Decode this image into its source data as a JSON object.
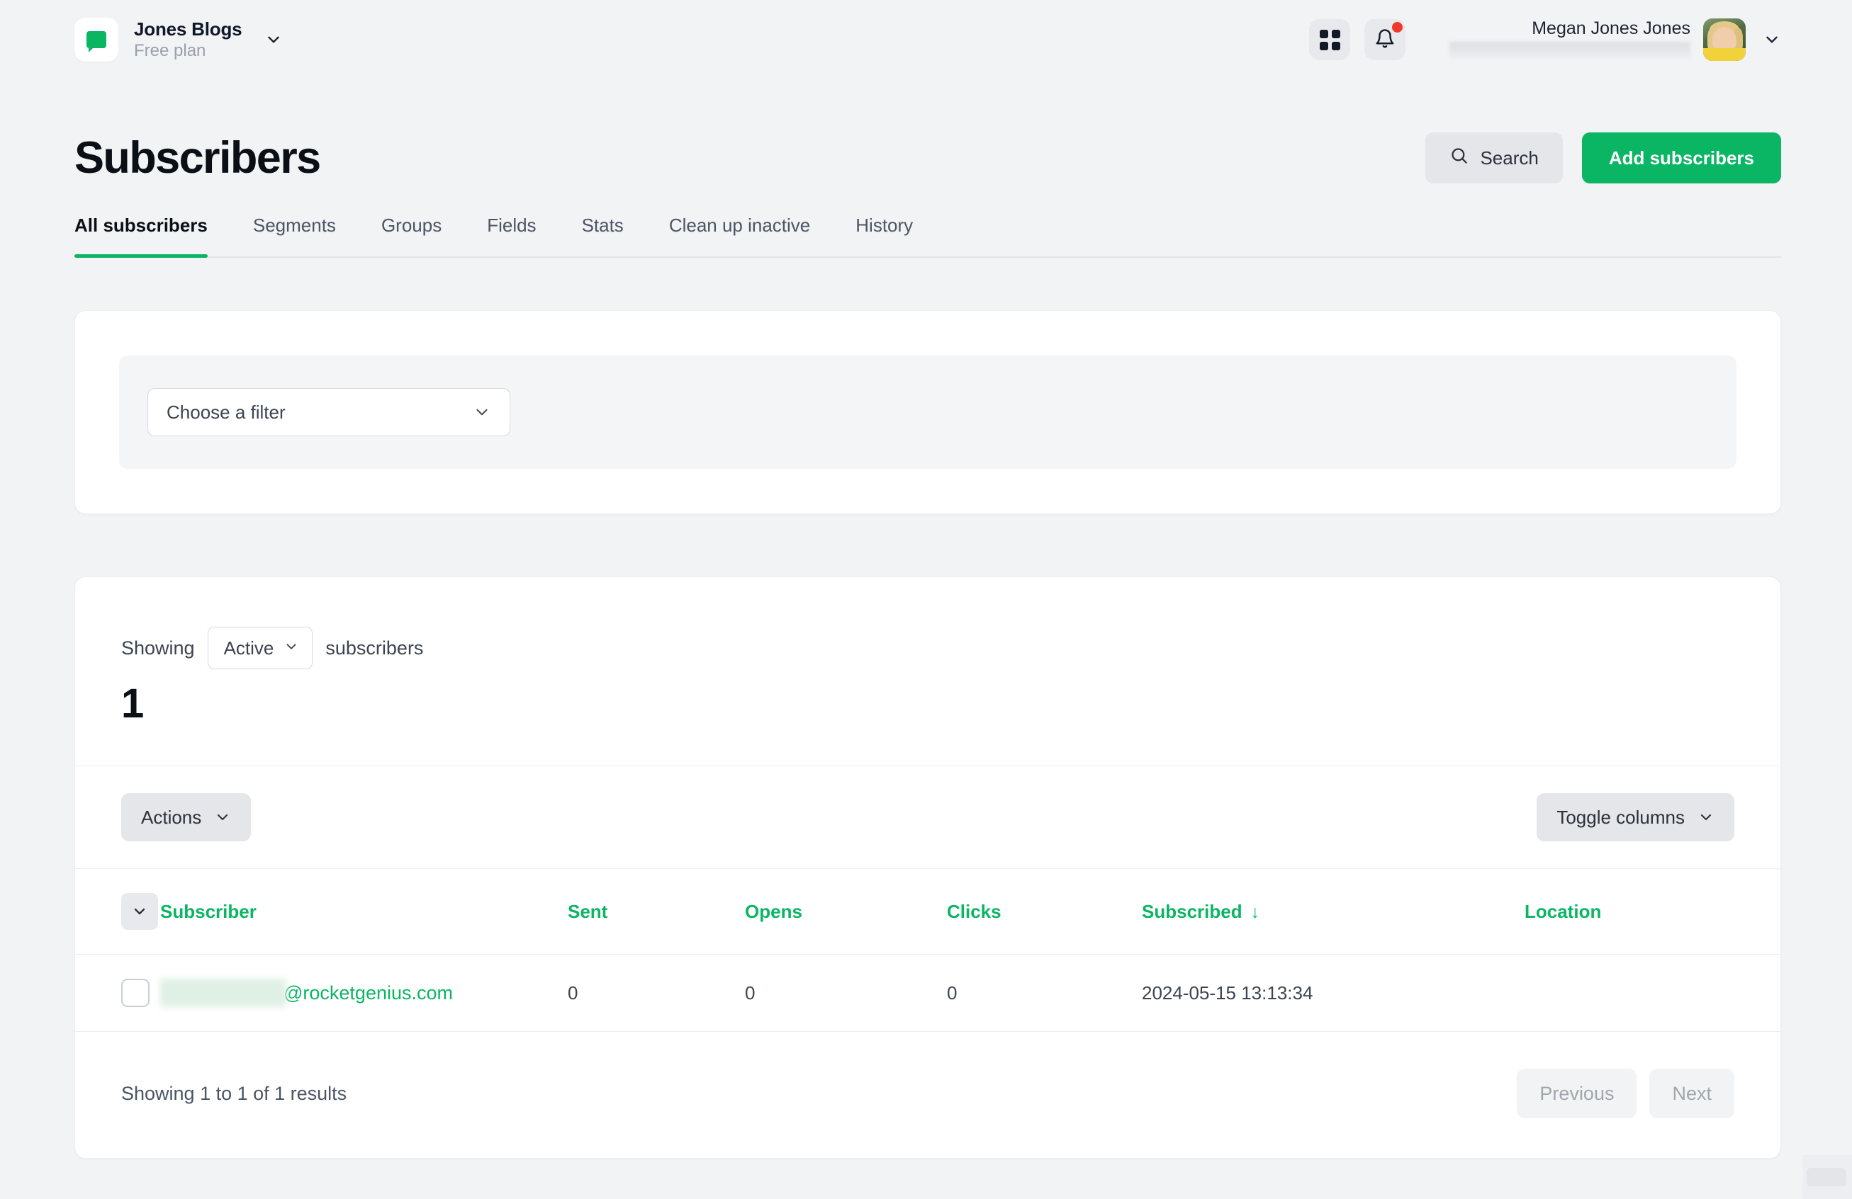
{
  "topbar": {
    "workspace_name": "Jones Blogs",
    "workspace_plan": "Free plan",
    "apps_icon": "grid-apps-icon",
    "notifications_icon": "bell-icon",
    "user_name": "Megan Jones Jones",
    "user_email_redacted": "",
    "avatar_alt": "user-avatar"
  },
  "page": {
    "title": "Subscribers",
    "search_label": "Search",
    "add_label": "Add subscribers"
  },
  "tabs": [
    {
      "label": "All subscribers",
      "active": true
    },
    {
      "label": "Segments",
      "active": false
    },
    {
      "label": "Groups",
      "active": false
    },
    {
      "label": "Fields",
      "active": false
    },
    {
      "label": "Stats",
      "active": false
    },
    {
      "label": "Clean up inactive",
      "active": false
    },
    {
      "label": "History",
      "active": false
    }
  ],
  "filter": {
    "select_value": "Choose a filter"
  },
  "summary": {
    "showing_prefix": "Showing",
    "status_value": "Active",
    "showing_suffix": "subscribers",
    "count": "1"
  },
  "toolbar": {
    "actions_label": "Actions",
    "toggle_columns_label": "Toggle columns"
  },
  "table": {
    "columns": [
      "Subscriber",
      "Sent",
      "Opens",
      "Clicks",
      "Subscribed",
      "Location"
    ],
    "sorted_column": "Subscribed",
    "sort_direction_glyph": "↓",
    "rows": [
      {
        "email_prefix_redacted": "",
        "email_domain": "@rocketgenius.com",
        "sent": "0",
        "opens": "0",
        "clicks": "0",
        "subscribed": "2024-05-15 13:13:34",
        "location": ""
      }
    ]
  },
  "pagination": {
    "results_text": "Showing 1 to 1 of 1 results",
    "previous_label": "Previous",
    "next_label": "Next"
  },
  "colors": {
    "accent_green": "#0ab563",
    "page_background": "#f1f3f5",
    "text_primary": "#0b0f16",
    "text_muted": "#9aa1ab",
    "notification_dot": "#f0392b"
  }
}
